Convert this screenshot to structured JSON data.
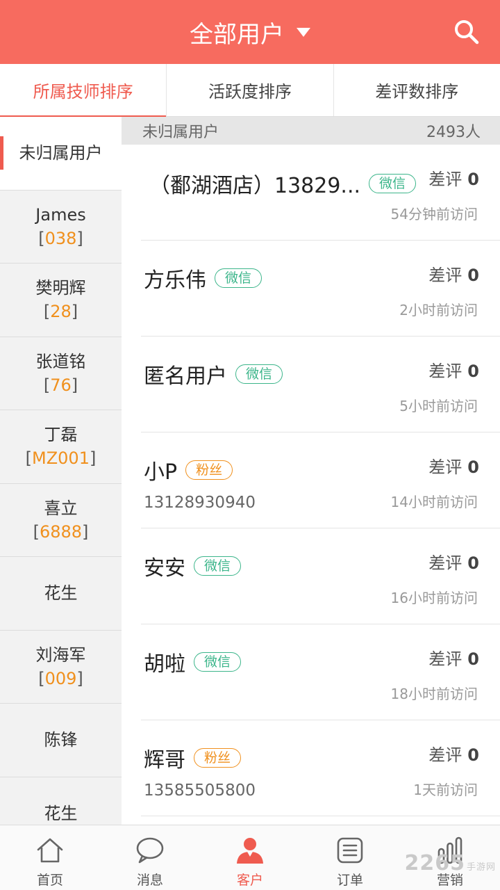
{
  "header": {
    "title": "全部用户",
    "accent": "#f76b5f"
  },
  "tabs": [
    {
      "label": "所属技师排序",
      "active": true
    },
    {
      "label": "活跃度排序",
      "active": false
    },
    {
      "label": "差评数排序",
      "active": false
    }
  ],
  "sidebar": {
    "items": [
      {
        "name": "未归属用户",
        "code": ""
      },
      {
        "name": "James",
        "code": "038"
      },
      {
        "name": "樊明辉",
        "code": "28"
      },
      {
        "name": "张道铭",
        "code": "76"
      },
      {
        "name": "丁磊",
        "code": "MZ001"
      },
      {
        "name": "喜立",
        "code": "6888"
      },
      {
        "name": "花生",
        "code": ""
      },
      {
        "name": "刘海军",
        "code": "009"
      },
      {
        "name": "陈锋",
        "code": ""
      },
      {
        "name": "花生",
        "code": ""
      }
    ]
  },
  "group": {
    "title": "未归属用户",
    "count": "2493人"
  },
  "review_label": "差评",
  "users": [
    {
      "name": "（鄱湖酒店）13829...",
      "tag": "微信",
      "bad": "0",
      "visit": "54分钟前访问",
      "phone": ""
    },
    {
      "name": "方乐伟",
      "tag": "微信",
      "bad": "0",
      "visit": "2小时前访问",
      "phone": ""
    },
    {
      "name": "匿名用户",
      "tag": "微信",
      "bad": "0",
      "visit": "5小时前访问",
      "phone": ""
    },
    {
      "name": "小P",
      "tag": "粉丝",
      "bad": "0",
      "visit": "14小时前访问",
      "phone": "13128930940"
    },
    {
      "name": "安安",
      "tag": "微信",
      "bad": "0",
      "visit": "16小时前访问",
      "phone": ""
    },
    {
      "name": "胡啦",
      "tag": "微信",
      "bad": "0",
      "visit": "18小时前访问",
      "phone": ""
    },
    {
      "name": "辉哥",
      "tag": "粉丝",
      "bad": "0",
      "visit": "1天前访问",
      "phone": "13585505800"
    }
  ],
  "nav": [
    {
      "label": "首页",
      "icon": "home-icon",
      "active": false
    },
    {
      "label": "消息",
      "icon": "message-icon",
      "active": false
    },
    {
      "label": "客户",
      "icon": "customer-icon",
      "active": true
    },
    {
      "label": "订单",
      "icon": "order-icon",
      "active": false
    },
    {
      "label": "营销",
      "icon": "marketing-icon",
      "active": false
    }
  ],
  "watermark": {
    "text": "2265",
    "sub": "手游网"
  }
}
